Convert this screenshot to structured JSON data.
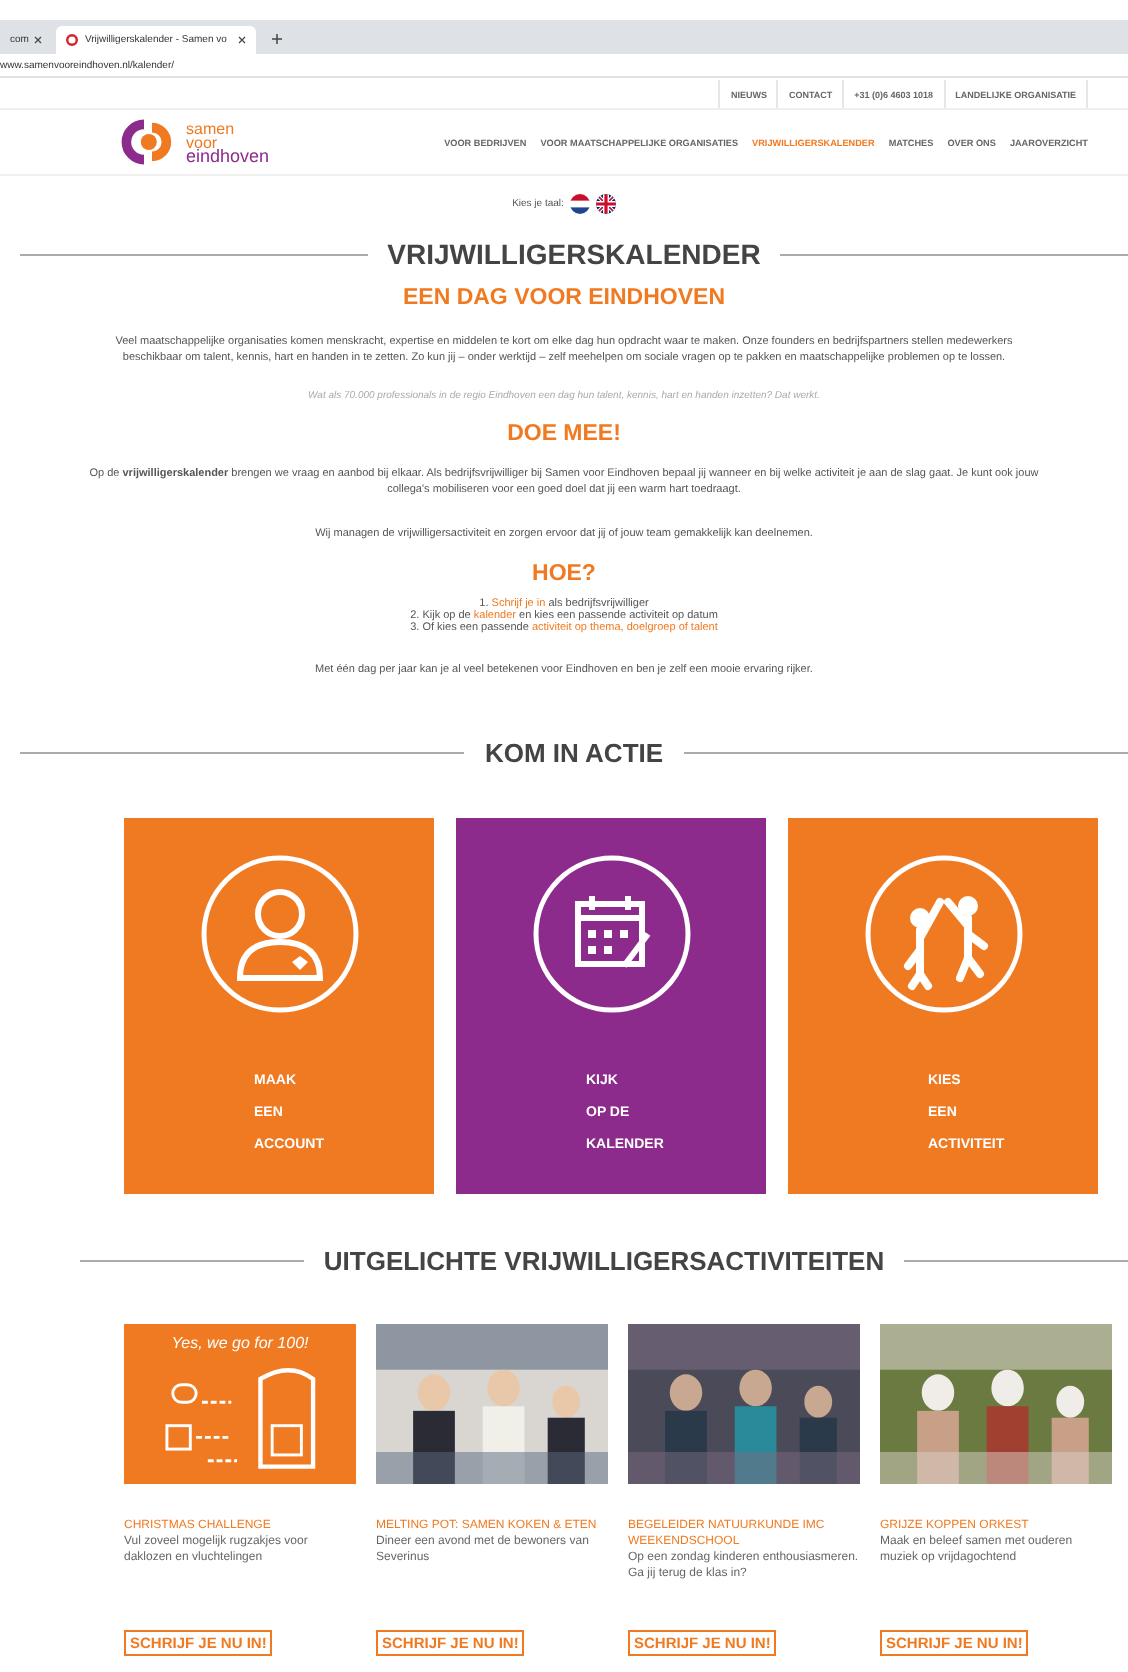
{
  "browser": {
    "tabs": [
      {
        "label": "com",
        "selected": false
      },
      {
        "label": "Vrijwilligerskalender - Samen vo",
        "selected": true
      }
    ],
    "url": "www.samenvooreindhoven.nl/kalender/"
  },
  "top_bar": [
    "NIEUWS",
    "CONTACT",
    "+31 (0)6 4603 1018",
    "LANDELIJKE ORGANISATIE"
  ],
  "logo": {
    "lines": [
      "samen",
      "voor",
      "eindhoven"
    ]
  },
  "nav": [
    {
      "label": "VOOR BEDRIJVEN",
      "selected": false
    },
    {
      "label": "VOOR MAATSCHAPPELIJKE ORGANISATIES",
      "selected": false
    },
    {
      "label": "VRIJWILLIGERSKALENDER",
      "selected": true
    },
    {
      "label": "MATCHES",
      "selected": false
    },
    {
      "label": "OVER ONS",
      "selected": false
    },
    {
      "label": "JAAROVERZICHT",
      "selected": false
    }
  ],
  "language": {
    "label": "Kies je taal:"
  },
  "title": "VRIJWILLIGERSKALENDER",
  "subtitle": "EEN DAG VOOR EINDHOVEN",
  "intro": "Veel maatschappelijke organisaties komen menskracht, expertise en middelen te kort om elke dag hun opdracht waar te maken. Onze founders en bedrijfspartners stellen medewerkers beschikbaar om talent, kennis, hart en handen in te zetten. Zo kun jij – onder werktijd – zelf meehelpen om sociale vragen op te pakken en maatschappelijke problemen op te lossen.",
  "quote": "Wat als 70.000 professionals in de regio Eindhoven een dag hun talent, kennis, hart en handen inzetten? Dat werkt.",
  "join_heading": "DOE MEE!",
  "join_text": "Op de **vrijwilligerskalender** brengen we vraag en aanbod bij elkaar. Als bedrijfsvrijwilliger bij Samen voor Eindhoven bepaal jij wanneer en bij welke activiteit je aan de slag gaat. Je kunt ook jouw collega's mobiliseren voor een goed doel dat jij een warm hart toedraagt.",
  "manage_text": "Wij managen de vrijwilligersactiviteit en zorgen ervoor dat jij of jouw team gemakkelijk kan deelnemen.",
  "how_heading": "HOE?",
  "steps": [
    {
      "before": "1. ",
      "link": "Schrijf je in",
      "after": " als bedrijfsvrijwilliger"
    },
    {
      "before": "2. Kijk op de ",
      "link": "kalender",
      "after": " en kies een passende activiteit op datum"
    },
    {
      "before": "3. Of kies een passende ",
      "link": "activiteit op thema, doelgroep of talent"
    }
  ],
  "closing": "Met één dag per jaar kan je al veel betekenen voor Eindhoven en ben je zelf een mooie ervaring rijker.",
  "action_heading": "KOM IN ACTIE",
  "actions": [
    {
      "kind": "account",
      "color": "#f07a21",
      "lines": [
        "MAAK",
        "EEN",
        "ACCOUNT"
      ]
    },
    {
      "kind": "calendar",
      "color": "#8c2b8c",
      "lines": [
        "KIJK",
        "OP DE",
        "KALENDER"
      ]
    },
    {
      "kind": "activity",
      "color": "#f07a21",
      "lines": [
        "KIES",
        "EEN",
        "ACTIVITEIT"
      ]
    }
  ],
  "featured_heading": "UITGELICHTE VRIJWILLIGERSACTIVITEITEN",
  "activities": [
    {
      "image": {
        "kind": "graphic",
        "caption": "Yes, we go for 100!"
      },
      "title": "CHRISTMAS CHALLENGE",
      "text": "Vul zoveel mogelijk rugzakjes voor daklozen en vluchtelingen",
      "button": "SCHRIJF JE NU IN!"
    },
    {
      "title": "MELTING POT: SAMEN KOKEN & ETEN",
      "text": "Dineer een avond met de bewoners van Severinus",
      "button": "SCHRIJF JE NU IN!"
    },
    {
      "title": "BEGELEIDER NATUURKUNDE IMC WEEKENDSCHOOL",
      "text": "Op een zondag kinderen enthousiasmeren. Ga jij terug de klas in?",
      "button": "SCHRIJF JE NU IN!"
    },
    {
      "title": "GRIJZE KOPPEN ORKEST",
      "text": "Maak en beleef samen met ouderen muziek op vrijdagochtend",
      "button": "SCHRIJF JE NU IN!"
    }
  ]
}
